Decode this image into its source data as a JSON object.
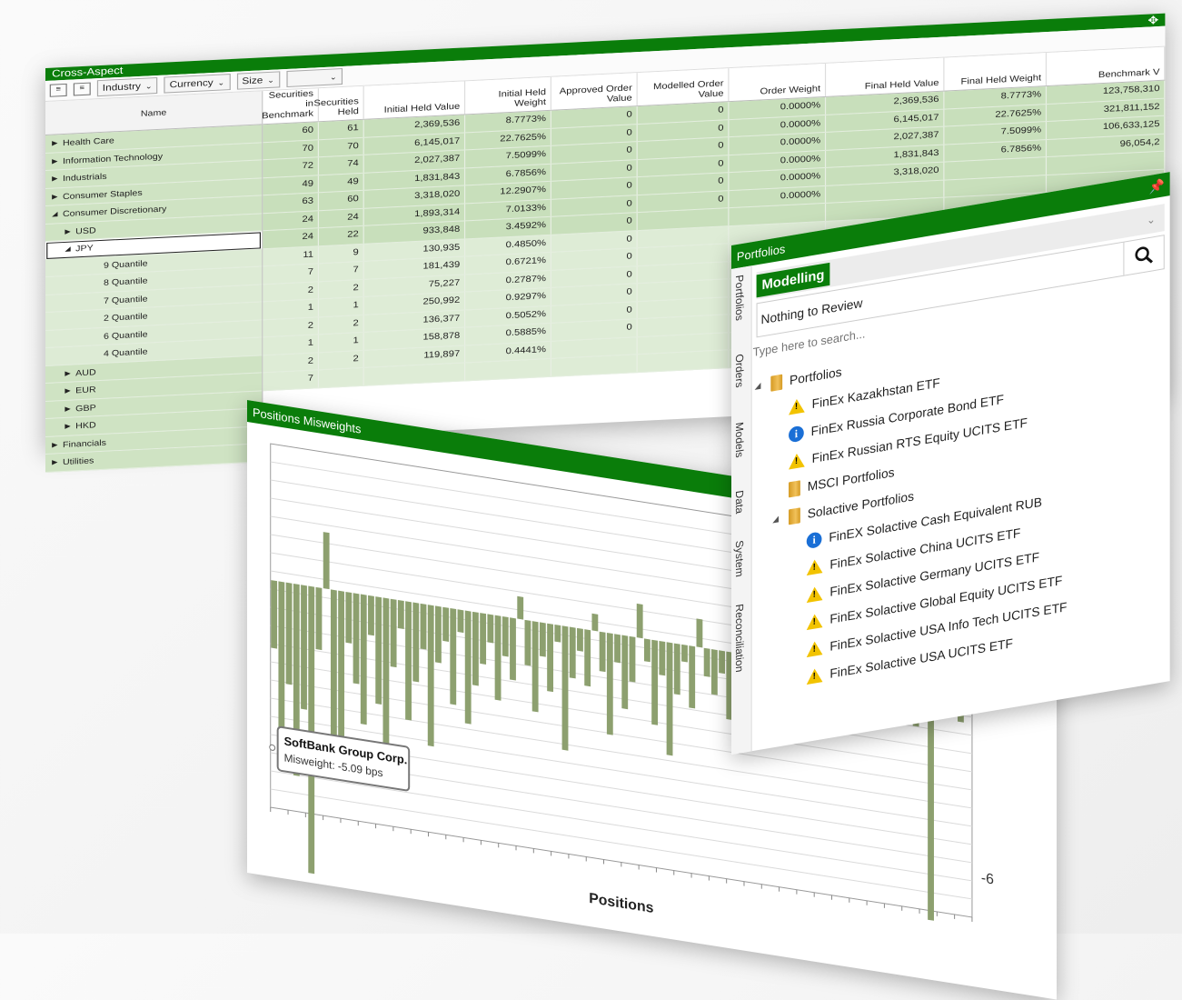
{
  "grid": {
    "title": "Cross-Aspect",
    "toolbar": {
      "dropdowns": [
        "Industry",
        "Currency",
        "Size",
        ""
      ]
    },
    "name_header": "Name",
    "columns": [
      "Securities in Benchmark",
      "Securities Held",
      "Initial Held Value",
      "Initial Held Weight",
      "Approved Order Value",
      "Modelled Order Value",
      "Order Weight",
      "Final Held Value",
      "Final Held Weight",
      "Benchmark V"
    ],
    "names": [
      {
        "label": "Health Care",
        "indent": 0,
        "arrow": "▶"
      },
      {
        "label": "Information Technology",
        "indent": 0,
        "arrow": "▶"
      },
      {
        "label": "Industrials",
        "indent": 0,
        "arrow": "▶"
      },
      {
        "label": "Consumer Staples",
        "indent": 0,
        "arrow": "▶"
      },
      {
        "label": "Consumer Discretionary",
        "indent": 0,
        "arrow": "◢"
      },
      {
        "label": "USD",
        "indent": 1,
        "arrow": "▶"
      },
      {
        "label": "JPY",
        "indent": 1,
        "arrow": "◢"
      },
      {
        "label": "9 Quantile",
        "indent": 2,
        "arrow": ""
      },
      {
        "label": "8 Quantile",
        "indent": 2,
        "arrow": ""
      },
      {
        "label": "7 Quantile",
        "indent": 2,
        "arrow": ""
      },
      {
        "label": "2 Quantile",
        "indent": 2,
        "arrow": ""
      },
      {
        "label": "6 Quantile",
        "indent": 2,
        "arrow": ""
      },
      {
        "label": "4 Quantile",
        "indent": 2,
        "arrow": ""
      },
      {
        "label": "AUD",
        "indent": 1,
        "arrow": "▶"
      },
      {
        "label": "EUR",
        "indent": 1,
        "arrow": "▶"
      },
      {
        "label": "GBP",
        "indent": 1,
        "arrow": "▶"
      },
      {
        "label": "HKD",
        "indent": 1,
        "arrow": "▶"
      },
      {
        "label": "Financials",
        "indent": 0,
        "arrow": "▶"
      },
      {
        "label": "Utilities",
        "indent": 0,
        "arrow": "▶"
      }
    ],
    "rows": [
      [
        "60",
        "61",
        "2,369,536",
        "8.7773%",
        "0",
        "0",
        "0.0000%",
        "2,369,536",
        "8.7773%",
        "123,758,310"
      ],
      [
        "70",
        "70",
        "6,145,017",
        "22.7625%",
        "0",
        "0",
        "0.0000%",
        "6,145,017",
        "22.7625%",
        "321,811,152"
      ],
      [
        "72",
        "74",
        "2,027,387",
        "7.5099%",
        "0",
        "0",
        "0.0000%",
        "2,027,387",
        "7.5099%",
        "106,633,125"
      ],
      [
        "49",
        "49",
        "1,831,843",
        "6.7856%",
        "0",
        "0",
        "0.0000%",
        "1,831,843",
        "6.7856%",
        "96,054,2"
      ],
      [
        "63",
        "60",
        "3,318,020",
        "12.2907%",
        "0",
        "0",
        "0.0000%",
        "3,318,020",
        "",
        ""
      ],
      [
        "24",
        "24",
        "1,893,314",
        "7.0133%",
        "0",
        "0",
        "0.0000%",
        "",
        "",
        ""
      ],
      [
        "24",
        "22",
        "933,848",
        "3.4592%",
        "0",
        "",
        "",
        "",
        "",
        ""
      ],
      [
        "11",
        "9",
        "130,935",
        "0.4850%",
        "0",
        "",
        "",
        "",
        "",
        ""
      ],
      [
        "7",
        "7",
        "181,439",
        "0.6721%",
        "0",
        "",
        "",
        "",
        "",
        ""
      ],
      [
        "2",
        "2",
        "75,227",
        "0.2787%",
        "0",
        "",
        "",
        "",
        "",
        ""
      ],
      [
        "1",
        "1",
        "250,992",
        "0.9297%",
        "0",
        "",
        "",
        "",
        "",
        ""
      ],
      [
        "2",
        "2",
        "136,377",
        "0.5052%",
        "0",
        "",
        "",
        "",
        "",
        ""
      ],
      [
        "1",
        "1",
        "158,878",
        "0.5885%",
        "0",
        "",
        "",
        "",
        "",
        ""
      ],
      [
        "2",
        "2",
        "119,897",
        "0.4441%",
        "",
        "",
        "",
        "",
        "",
        ""
      ],
      [
        "7",
        "",
        "",
        "",
        "",
        "",
        "",
        "",
        "",
        ""
      ]
    ]
  },
  "chart": {
    "title": "Positions Misweights",
    "xlabel": "Positions",
    "tick_label": "-6",
    "tooltip_name": "SoftBank Group Corp.",
    "tooltip_value": "Misweight: -5.09 bps",
    "bar_color": "#8da06f"
  },
  "chart_data": {
    "type": "bar",
    "title": "Positions Misweights",
    "xlabel": "Positions",
    "ylabel": "",
    "y_tick_labels": [
      "-6"
    ],
    "values": [
      -1.2,
      -2.9,
      -1.8,
      -3.4,
      -2.2,
      -5.09,
      -1.1,
      1.0,
      -2.6,
      -3.0,
      -0.9,
      -1.6,
      -2.3,
      -0.7,
      -1.9,
      -2.8,
      -1.2,
      -0.5,
      -2.1,
      -1.4,
      -0.8,
      -2.5,
      -1.0,
      -0.6,
      -1.7,
      -0.4,
      -2.0,
      -1.3,
      -0.9,
      -0.5,
      -1.5,
      -0.7,
      -1.1,
      0.4,
      -0.8,
      -1.6,
      -0.6,
      -1.2,
      -0.3,
      -2.2,
      -0.9,
      -0.4,
      -1.0,
      0.3,
      -0.7,
      -1.8,
      -0.5,
      -1.3,
      -0.8,
      0.6,
      -0.4,
      -1.5,
      -0.6,
      -2.0,
      -0.9,
      -0.3,
      -1.1,
      0.5,
      -0.5,
      -0.8,
      -0.4,
      -1.2,
      0.8,
      -0.6,
      -1.4,
      -0.3,
      -0.9,
      0.4,
      -0.5,
      -1.0,
      -0.7,
      -0.4,
      1.0,
      -0.6,
      -0.8,
      -0.3,
      -1.1,
      0.6,
      -0.4,
      -0.7,
      0.5,
      -0.9,
      -0.3,
      -0.6,
      0.7,
      -0.4,
      -0.8,
      0.3,
      -4.2,
      -0.5,
      -0.3,
      0.4,
      -0.6,
      -0.4
    ],
    "highlight": {
      "name": "SoftBank Group Corp.",
      "value": -5.09
    }
  },
  "portfolios": {
    "title": "Portfolios",
    "mode": "Modelling",
    "review": "Nothing to Review",
    "search_placeholder": "Type here to search...",
    "vtabs": [
      "Portfolios",
      "Orders",
      "Models",
      "Data",
      "System",
      "Reconciliation"
    ],
    "tree": [
      {
        "label": "Portfolios",
        "level": 0,
        "icon": "folder",
        "arrow": "◢"
      },
      {
        "label": "FinEx Kazakhstan ETF",
        "level": 1,
        "icon": "warning"
      },
      {
        "label": "FinEx Russia Corporate Bond ETF",
        "level": 1,
        "icon": "info"
      },
      {
        "label": "FinEx Russian RTS Equity UCITS ETF",
        "level": 1,
        "icon": "warning"
      },
      {
        "label": "MSCI Portfolios",
        "level": 1,
        "icon": "folder"
      },
      {
        "label": "Solactive Portfolios",
        "level": 1,
        "icon": "folder",
        "arrow": "◢"
      },
      {
        "label": "FinEX Solactive Cash Equivalent RUB",
        "level": 2,
        "icon": "info"
      },
      {
        "label": "FinEx Solactive China UCITS ETF",
        "level": 2,
        "icon": "warning"
      },
      {
        "label": "FinEx Solactive Germany UCITS ETF",
        "level": 2,
        "icon": "warning"
      },
      {
        "label": "FinEx Solactive Global Equity UCITS ETF",
        "level": 2,
        "icon": "warning"
      },
      {
        "label": "FinEx Solactive USA Info Tech UCITS ETF",
        "level": 2,
        "icon": "warning"
      },
      {
        "label": "FinEx Solactive USA UCITS ETF",
        "level": 2,
        "icon": "warning"
      }
    ]
  }
}
